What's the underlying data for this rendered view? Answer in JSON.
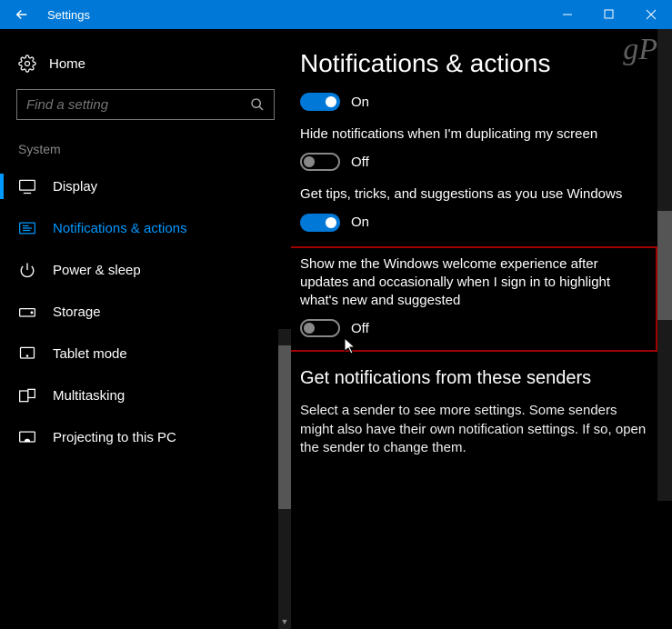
{
  "titlebar": {
    "title": "Settings"
  },
  "watermark": "gP",
  "sidebar": {
    "home": "Home",
    "search_placeholder": "Find a setting",
    "section": "System",
    "items": [
      {
        "label": "Display"
      },
      {
        "label": "Notifications & actions"
      },
      {
        "label": "Power & sleep"
      },
      {
        "label": "Storage"
      },
      {
        "label": "Tablet mode"
      },
      {
        "label": "Multitasking"
      },
      {
        "label": "Projecting to this PC"
      }
    ]
  },
  "main": {
    "heading": "Notifications & actions",
    "toggles": [
      {
        "state": "On",
        "desc": ""
      },
      {
        "state": "Off",
        "desc": "Hide notifications when I'm duplicating my screen"
      },
      {
        "state": "On",
        "desc": "Get tips, tricks, and suggestions as you use Windows"
      },
      {
        "state": "Off",
        "desc": "Show me the Windows welcome experience after updates and occasionally when I sign in to highlight what's new and suggested"
      }
    ],
    "sub_heading": "Get notifications from these senders",
    "sub_text": "Select a sender to see more settings. Some senders might also have their own notification settings. If so, open the sender to change them."
  }
}
